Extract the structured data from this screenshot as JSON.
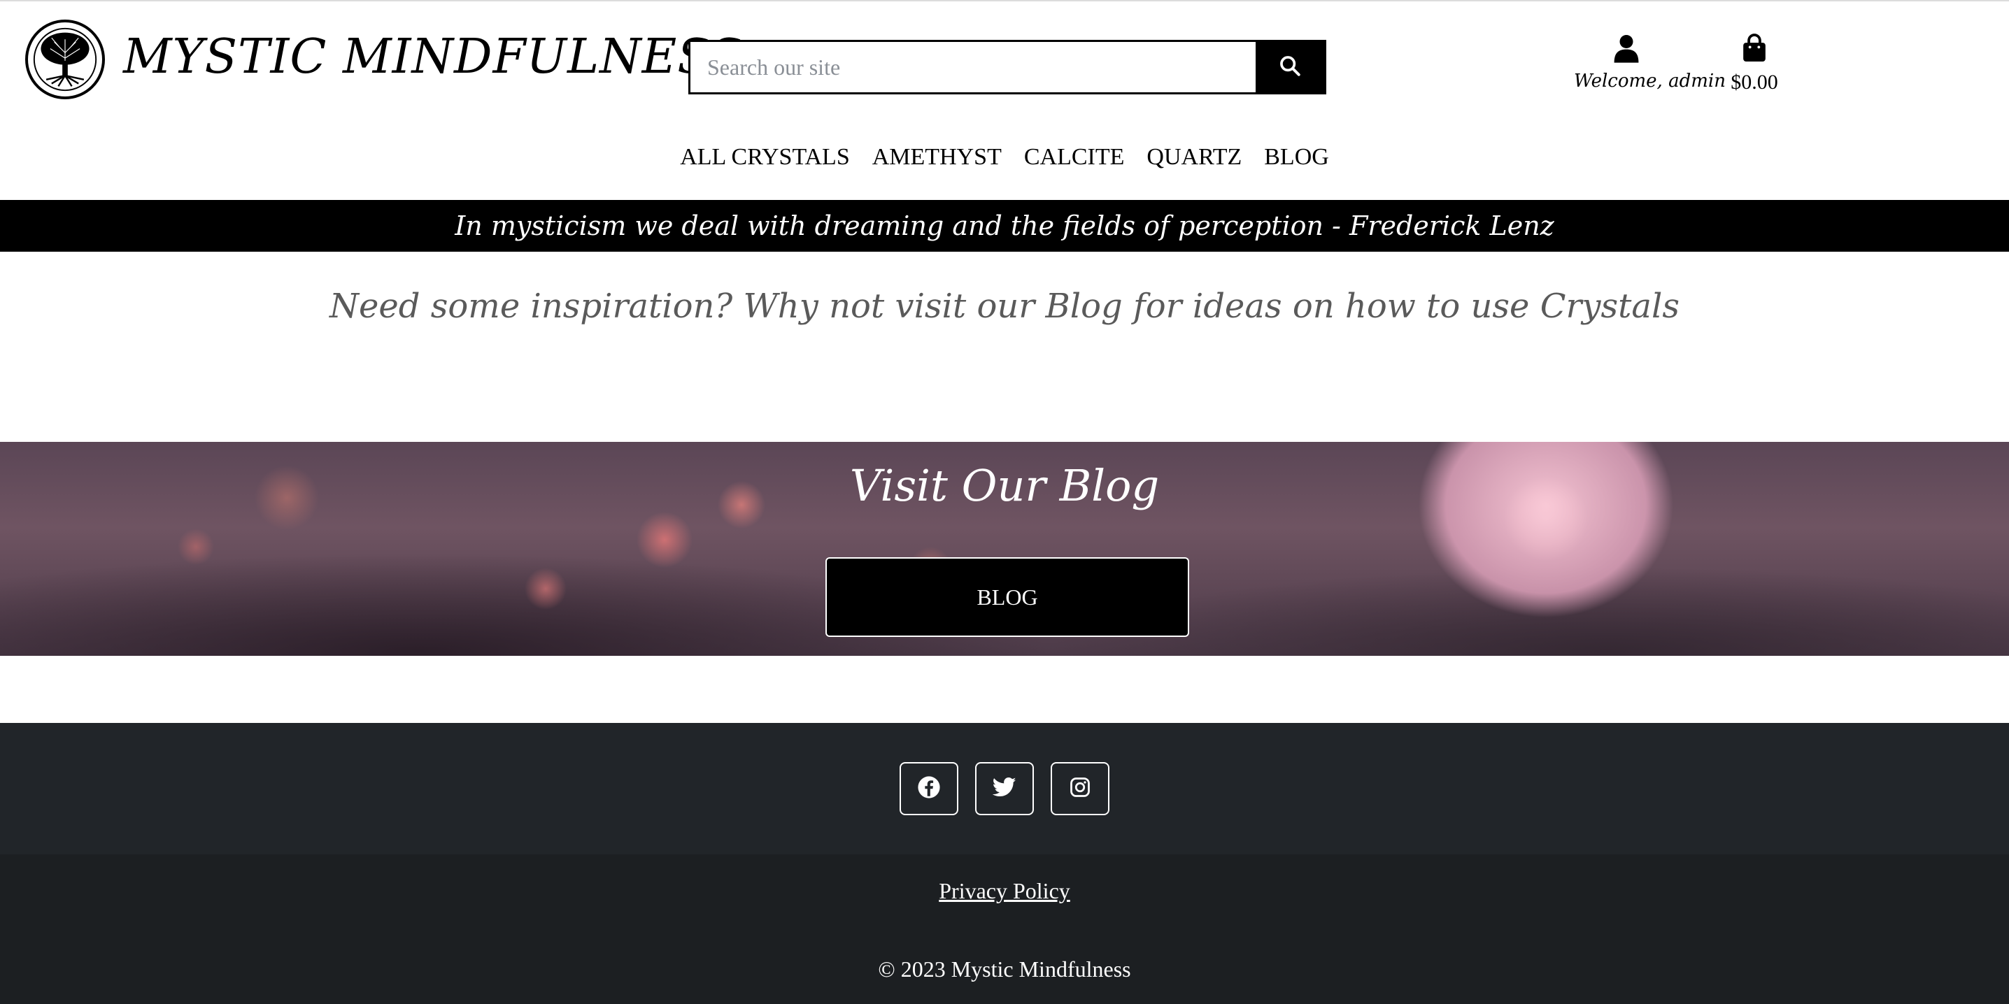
{
  "header": {
    "brand": "MYSTIC MINDFULNESS",
    "search": {
      "placeholder": "Search our site",
      "value": ""
    },
    "account_label": "Welcome, admin",
    "cart_total": "$0.00"
  },
  "nav": {
    "items": [
      {
        "label": "ALL CRYSTALS"
      },
      {
        "label": "AMETHYST"
      },
      {
        "label": "CALCITE"
      },
      {
        "label": "QUARTZ"
      },
      {
        "label": "BLOG"
      }
    ]
  },
  "banner": {
    "quote": "In mysticism we deal with dreaming and the fields of perception - Frederick Lenz"
  },
  "main": {
    "inspiration": "Need some inspiration? Why not visit our Blog for ideas on how to use Crystals",
    "hero": {
      "title": "Visit Our Blog",
      "button_label": "BLOG"
    }
  },
  "footer": {
    "socials": [
      "facebook-icon",
      "twitter-icon",
      "instagram-icon"
    ],
    "privacy_label": "Privacy Policy",
    "copyright": "© 2023 Mystic Mindfulness"
  },
  "colors": {
    "quote_bar": "#000000",
    "footer_top": "#212529",
    "footer_bottom": "#1c1f22",
    "inspiration_text": "#5a5a5a"
  }
}
